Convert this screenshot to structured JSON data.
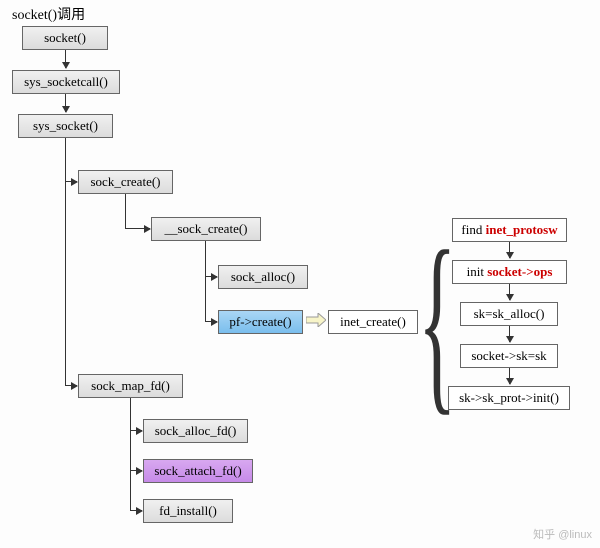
{
  "title": "socket()调用",
  "nodes": {
    "socket": "socket()",
    "sys_socketcall": "sys_socketcall()",
    "sys_socket": "sys_socket()",
    "sock_create": "sock_create()",
    "__sock_create": "__sock_create()",
    "sock_alloc": "sock_alloc()",
    "pf_create": "pf->create()",
    "inet_create": "inet_create()",
    "sock_map_fd": "sock_map_fd()",
    "sock_alloc_fd": "sock_alloc_fd()",
    "sock_attach_fd": "sock_attach_fd()",
    "fd_install": "fd_install()",
    "find_inet_protosw_prefix": "find ",
    "find_inet_protosw_red": "inet_protosw",
    "init_socket_ops_prefix": "init ",
    "init_socket_ops_red": "socket->ops",
    "sk_sk_alloc": "sk=sk_alloc()",
    "socket_sk_sk": "socket->sk=sk",
    "sk_sk_prot_init": "sk->sk_prot->init()"
  },
  "watermark": "知乎 @linux"
}
